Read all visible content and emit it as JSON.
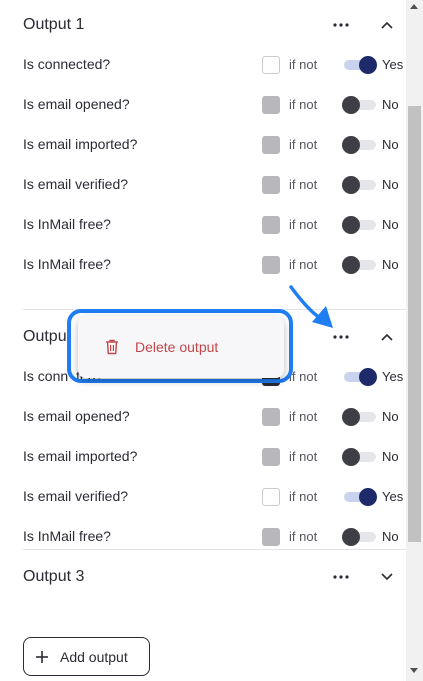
{
  "outputs": [
    {
      "title": "Output 1",
      "rows": [
        {
          "label": "Is connected?",
          "checkbox": "empty",
          "if_not": "if not",
          "toggle": "on",
          "toggle_label": "Yes"
        },
        {
          "label": "Is email opened?",
          "checkbox": "grey",
          "if_not": "if not",
          "toggle": "off",
          "toggle_label": "No"
        },
        {
          "label": "Is email imported?",
          "checkbox": "grey",
          "if_not": "if not",
          "toggle": "off",
          "toggle_label": "No"
        },
        {
          "label": "Is email verified?",
          "checkbox": "grey",
          "if_not": "if not",
          "toggle": "off",
          "toggle_label": "No"
        },
        {
          "label": "Is InMail free?",
          "checkbox": "grey",
          "if_not": "if not",
          "toggle": "off",
          "toggle_label": "No"
        },
        {
          "label": "Is InMail free?",
          "checkbox": "grey",
          "if_not": "if not",
          "toggle": "off",
          "toggle_label": "No"
        }
      ]
    },
    {
      "title": "Outpu",
      "rows": [
        {
          "label": "Is conn",
          "label_tail": "ted?",
          "checkbox": "dark",
          "if_not": "if not",
          "toggle": "on",
          "toggle_label": "Yes"
        },
        {
          "label": "Is email opened?",
          "checkbox": "grey",
          "if_not": "if not",
          "toggle": "off",
          "toggle_label": "No"
        },
        {
          "label": "Is email imported?",
          "checkbox": "grey",
          "if_not": "if not",
          "toggle": "off",
          "toggle_label": "No"
        },
        {
          "label": "Is email verified?",
          "checkbox": "empty",
          "if_not": "if not",
          "toggle": "on",
          "toggle_label": "Yes"
        },
        {
          "label": "Is InMail free?",
          "checkbox": "grey",
          "if_not": "if not",
          "toggle": "off",
          "toggle_label": "No"
        }
      ]
    },
    {
      "title": "Output 3",
      "rows": []
    }
  ],
  "menu": {
    "delete_label": "Delete output",
    "delete_icon": "trash-icon"
  },
  "add_output_label": "Add output",
  "icons": {
    "more": "more-horizontal-icon",
    "chevron_up": "chevron-up-icon",
    "chevron_down": "chevron-down-icon",
    "plus": "plus-icon",
    "arrow": "pointer-arrow-icon"
  },
  "colors": {
    "highlight": "#1f7ef2",
    "toggle_on_knob": "#1d2b6b",
    "toggle_on_track": "#c9d3f0",
    "delete_text": "#c0474b"
  }
}
